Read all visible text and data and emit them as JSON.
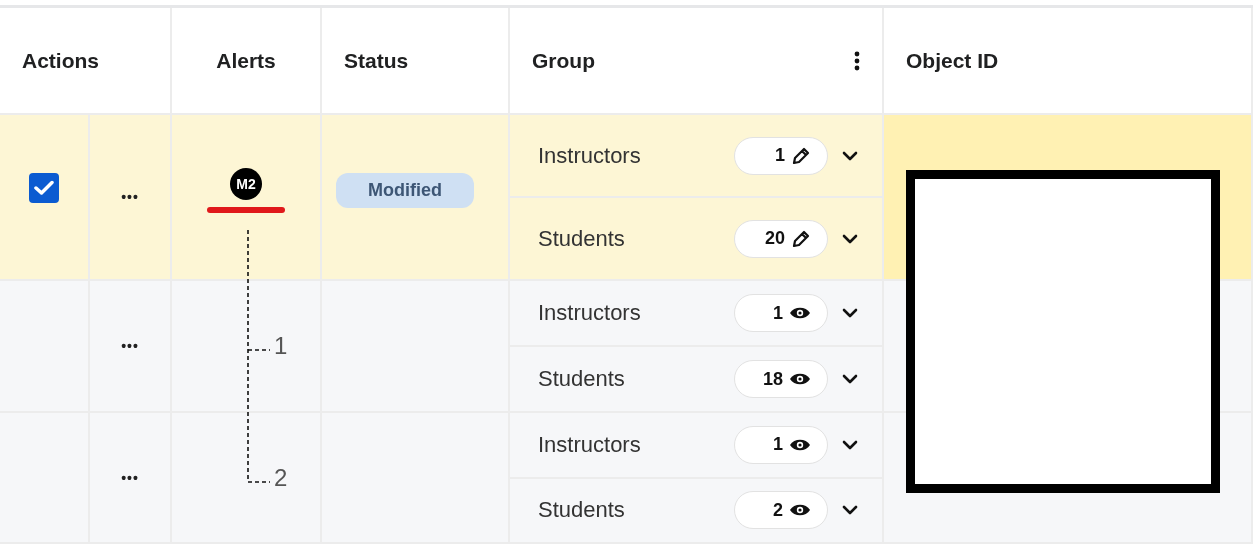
{
  "columns": [
    {
      "label": "Actions"
    },
    {
      "label": "Alerts"
    },
    {
      "label": "Status"
    },
    {
      "label": "Group",
      "menu": true
    },
    {
      "label": "Object ID"
    }
  ],
  "rows": [
    {
      "selected": true,
      "actions": "•••",
      "alert_badge": "M2",
      "alert_ref": null,
      "status": "Modified",
      "groups": [
        {
          "name": "Instructors",
          "count": "1",
          "kind": "edit"
        },
        {
          "name": "Students",
          "count": "20",
          "kind": "edit"
        }
      ]
    },
    {
      "selected": false,
      "actions": "•••",
      "alert_badge": null,
      "alert_ref": "1",
      "status": null,
      "groups": [
        {
          "name": "Instructors",
          "count": "1",
          "kind": "view"
        },
        {
          "name": "Students",
          "count": "18",
          "kind": "view"
        }
      ]
    },
    {
      "selected": false,
      "actions": "•••",
      "alert_badge": null,
      "alert_ref": "2",
      "status": null,
      "groups": [
        {
          "name": "Instructors",
          "count": "1",
          "kind": "view"
        },
        {
          "name": "Students",
          "count": "2",
          "kind": "view"
        }
      ]
    }
  ]
}
